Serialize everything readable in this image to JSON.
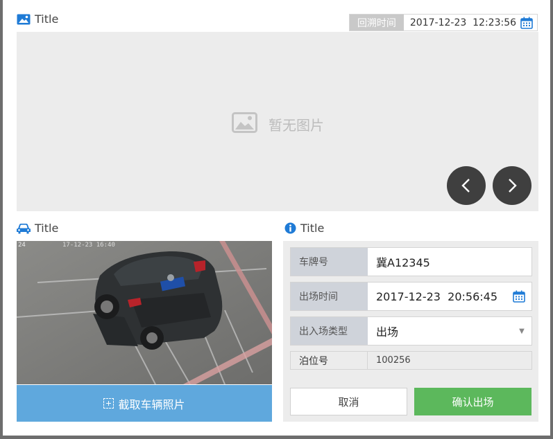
{
  "main_section": {
    "title": "Title",
    "icon": "image-icon",
    "backtrack": {
      "label": "回溯时间",
      "value": "2017-12-23  12:23:56",
      "icon": "calendar-icon"
    },
    "placeholder": {
      "text": "暂无图片",
      "icon": "image-placeholder-icon"
    },
    "nav": {
      "prev_icon": "chevron-left-icon",
      "next_icon": "chevron-right-icon"
    }
  },
  "vehicle_section": {
    "title": "Title",
    "icon": "car-icon",
    "photo": {
      "timestamp_left": "24",
      "timestamp_right": "17-12-23 16:40"
    },
    "capture_button": "截取车辆照片"
  },
  "info_section": {
    "title": "Title",
    "icon": "info-icon",
    "fields": {
      "plate": {
        "label": "车牌号",
        "value": "冀A12345"
      },
      "exit_time": {
        "label": "出场时间",
        "value": "2017-12-23  20:56:45"
      },
      "entry_type": {
        "label": "出入场类型",
        "value": "出场"
      },
      "berth": {
        "label": "泊位号",
        "value": "100256"
      }
    },
    "cancel_button": "取消",
    "confirm_button": "确认出场"
  },
  "colors": {
    "accent_blue": "#1f7bd6",
    "capture_bg": "#5fa8dd",
    "confirm_green": "#5cb85c",
    "nav_dark": "#3f3f3f",
    "panel_gray": "#ececec"
  }
}
